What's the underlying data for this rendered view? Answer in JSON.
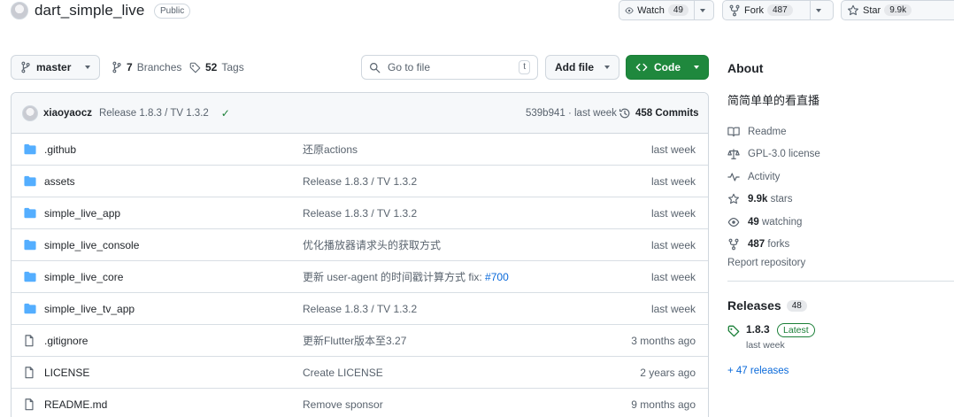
{
  "repo": {
    "name": "dart_simple_live",
    "visibility": "Public",
    "watch": {
      "label": "Watch",
      "count": "49"
    },
    "fork": {
      "label": "Fork",
      "count": "487"
    },
    "star": {
      "label": "Star",
      "count": "9.9k"
    }
  },
  "toolbar": {
    "branch": "master",
    "branches": {
      "count": "7",
      "label": "Branches"
    },
    "tags": {
      "count": "52",
      "label": "Tags"
    },
    "search_placeholder": "Go to file",
    "search_shortcut": "t",
    "add_file": "Add file",
    "code": "Code"
  },
  "latest_commit": {
    "author": "xiaoyaocz",
    "message": "Release 1.8.3 / TV 1.3.2",
    "sha_time": "539b941 · last week",
    "commits": "458 Commits"
  },
  "files": [
    {
      "type": "folder",
      "name": ".github",
      "message": "还原actions",
      "issue": "",
      "date": "last week"
    },
    {
      "type": "folder",
      "name": "assets",
      "message": "Release 1.8.3 / TV 1.3.2",
      "issue": "",
      "date": "last week"
    },
    {
      "type": "folder",
      "name": "simple_live_app",
      "message": "Release 1.8.3 / TV 1.3.2",
      "issue": "",
      "date": "last week"
    },
    {
      "type": "folder",
      "name": "simple_live_console",
      "message": "优化播放器请求头的获取方式",
      "issue": "",
      "date": "last week"
    },
    {
      "type": "folder",
      "name": "simple_live_core",
      "message": "更新 user-agent 的时间戳计算方式 fix: ",
      "issue": "#700",
      "date": "last week"
    },
    {
      "type": "folder",
      "name": "simple_live_tv_app",
      "message": "Release 1.8.3 / TV 1.3.2",
      "issue": "",
      "date": "last week"
    },
    {
      "type": "file",
      "name": ".gitignore",
      "message": "更新Flutter版本至3.27",
      "issue": "",
      "date": "3 months ago"
    },
    {
      "type": "file",
      "name": "LICENSE",
      "message": "Create LICENSE",
      "issue": "",
      "date": "2 years ago"
    },
    {
      "type": "file",
      "name": "README.md",
      "message": "Remove sponsor",
      "issue": "",
      "date": "9 months ago"
    }
  ],
  "about": {
    "title": "About",
    "description": "简简单单的看直播",
    "items": [
      {
        "icon": "book-icon",
        "bold": "",
        "text": "Readme"
      },
      {
        "icon": "law-icon",
        "bold": "",
        "text": "GPL-3.0 license"
      },
      {
        "icon": "pulse-icon",
        "bold": "",
        "text": "Activity"
      },
      {
        "icon": "star-icon",
        "bold": "9.9k",
        "text": " stars"
      },
      {
        "icon": "eye-icon",
        "bold": "49",
        "text": " watching"
      },
      {
        "icon": "fork-icon",
        "bold": "487",
        "text": " forks"
      }
    ],
    "report": "Report repository"
  },
  "releases": {
    "title": "Releases",
    "count": "48",
    "latest_version": "1.8.3",
    "latest_badge": "Latest",
    "latest_date": "last week",
    "more": "+ 47 releases"
  },
  "colors": {
    "accent_green": "#1f883d",
    "link_blue": "#0969da",
    "folder_blue": "#54aeff",
    "muted": "#59636e"
  }
}
